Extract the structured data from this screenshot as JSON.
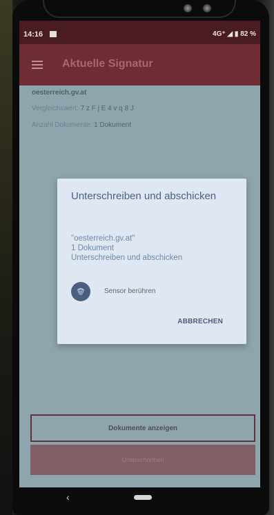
{
  "status_bar": {
    "time": "14:16",
    "network": "4G⁺",
    "battery": "82 %"
  },
  "app_bar": {
    "title": "Aktuelle Signatur"
  },
  "info": {
    "domain": "oesterreich.gv.at",
    "compare_label": "Vergleichswert:",
    "compare_value": "7 z F j E 4 v q 8 J",
    "count_label": "Anzahl Dokumente:",
    "count_value": "1 Dokument"
  },
  "dialog": {
    "title": "Unterschreiben und abschicken",
    "body_line1": "\"oesterreich.gv.at\"",
    "body_line2": "1 Dokument",
    "body_line3": "Unterschreiben und abschicken",
    "sensor_label": "Sensor berühren",
    "cancel_label": "ABBRECHEN"
  },
  "buttons": {
    "show_documents": "Dokumente anzeigen",
    "sign": "Unterschreiben"
  },
  "colors": {
    "primary_dark": "#4a1c22",
    "primary": "#6e2c34",
    "dialog_bg": "#dfe7f2",
    "accent_text": "#4c5f8a"
  },
  "icons": {
    "menu": "hamburger-icon",
    "fingerprint": "fingerprint-icon",
    "back": "back-icon",
    "home": "home-pill-icon"
  }
}
